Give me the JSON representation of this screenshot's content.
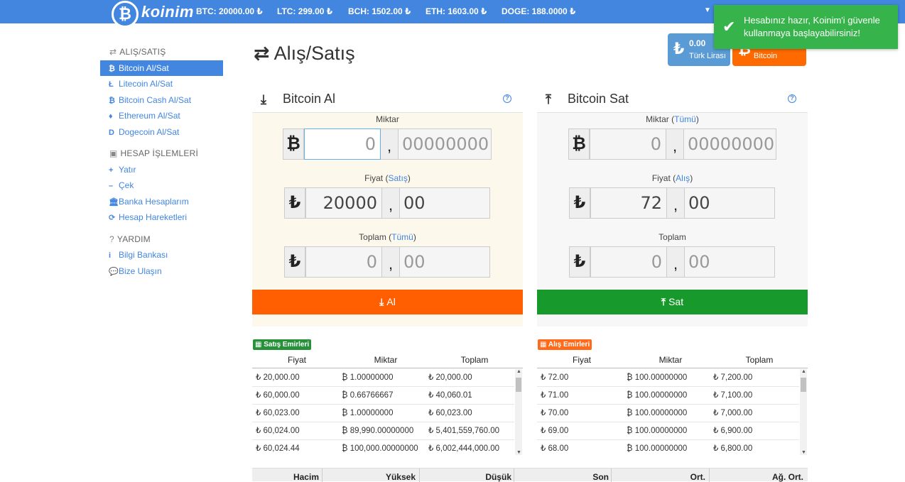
{
  "brand": {
    "logo_glyph": "₿",
    "name": "koinim"
  },
  "tickers": [
    "BTC: 20000.00 ₺",
    "LTC: 299.00 ₺",
    "BCH: 1502.00 ₺",
    "ETH: 1603.00 ₺",
    "DOGE: 188.0000 ₺"
  ],
  "toast": {
    "message": "Hesabınız hazır, Koinim'i güvenle kullanmaya başlayabilirsiniz!"
  },
  "balances": {
    "try": {
      "amount": "0.00",
      "label": "Türk Lirası",
      "symbol": "₺"
    },
    "btc": {
      "label": "Bitcoin",
      "symbol": "₿"
    }
  },
  "sidebar": {
    "sections": [
      {
        "title": "ALIŞ/SATIŞ",
        "icon": "exchange-icon"
      },
      {
        "title": "HESAP İŞLEMLERİ",
        "icon": "briefcase-icon"
      },
      {
        "title": "YARDIM",
        "icon": "question-icon"
      }
    ],
    "trade_items": [
      {
        "label": "Bitcoin Al/Sat",
        "icon": "₿"
      },
      {
        "label": "Litecoin Al/Sat",
        "icon": "Ł"
      },
      {
        "label": "Bitcoin Cash Al/Sat",
        "icon": "₿"
      },
      {
        "label": "Ethereum Al/Sat",
        "icon": "♦"
      },
      {
        "label": "Dogecoin Al/Sat",
        "icon": "D"
      }
    ],
    "account_items": [
      {
        "label": "Yatır",
        "icon": "+"
      },
      {
        "label": "Çek",
        "icon": "–"
      },
      {
        "label": "Banka Hesaplarım",
        "icon": "🏛"
      },
      {
        "label": "Hesap Hareketleri",
        "icon": "⟳"
      }
    ],
    "help_items": [
      {
        "label": "Bilgi Bankası",
        "icon": "i"
      },
      {
        "label": "Bize Ulaşın",
        "icon": "💬"
      }
    ]
  },
  "page": {
    "title": "Alış/Satış"
  },
  "buy": {
    "title": "Bitcoin Al",
    "help": "?",
    "amount_label": "Miktar",
    "amount_int": "0",
    "amount_dec": "00000000",
    "price_label": "Fiyat",
    "price_link": "Satış",
    "price_int": "20000",
    "price_dec": "00",
    "total_label": "Toplam",
    "total_link": "Tümü",
    "total_int": "0",
    "total_dec": "00",
    "button": "Al"
  },
  "sell": {
    "title": "Bitcoin Sat",
    "help": "?",
    "amount_label": "Miktar",
    "amount_link": "Tümü",
    "amount_int": "0",
    "amount_dec": "00000000",
    "price_label": "Fiyat",
    "price_link": "Alış",
    "price_int": "72",
    "price_dec": "00",
    "total_label": "Toplam",
    "total_int": "0",
    "total_dec": "00",
    "button": "Sat"
  },
  "sell_orders": {
    "badge": "Satış Emirleri",
    "columns": [
      "Fiyat",
      "Miktar",
      "Toplam"
    ],
    "rows": [
      [
        "₺ 20,000.00",
        "₿ 1.00000000",
        "₺ 20,000.00"
      ],
      [
        "₺ 60,000.00",
        "₿ 0.66766667",
        "₺ 40,060.01"
      ],
      [
        "₺ 60,023.00",
        "₿ 1.00000000",
        "₺ 60,023.00"
      ],
      [
        "₺ 60,024.00",
        "₿ 89,990.00000000",
        "₺ 5,401,559,760.00"
      ],
      [
        "₺ 60,024.44",
        "₿ 100,000.00000000",
        "₺ 6,002,444,000.00"
      ]
    ]
  },
  "buy_orders": {
    "badge": "Alış Emirleri",
    "columns": [
      "Fiyat",
      "Miktar",
      "Toplam"
    ],
    "rows": [
      [
        "₺ 72.00",
        "₿ 100.00000000",
        "₺ 7,200.00"
      ],
      [
        "₺ 71.00",
        "₿ 100.00000000",
        "₺ 7,100.00"
      ],
      [
        "₺ 70.00",
        "₿ 100.00000000",
        "₺ 7,000.00"
      ],
      [
        "₺ 69.00",
        "₿ 100.00000000",
        "₺ 6,900.00"
      ],
      [
        "₺ 68.00",
        "₿ 100.00000000",
        "₺ 6,800.00"
      ]
    ]
  },
  "stats": {
    "columns": [
      "Hacim",
      "Yüksek",
      "Düşük",
      "Son",
      "Ort.",
      "Ağ. Ort."
    ]
  }
}
